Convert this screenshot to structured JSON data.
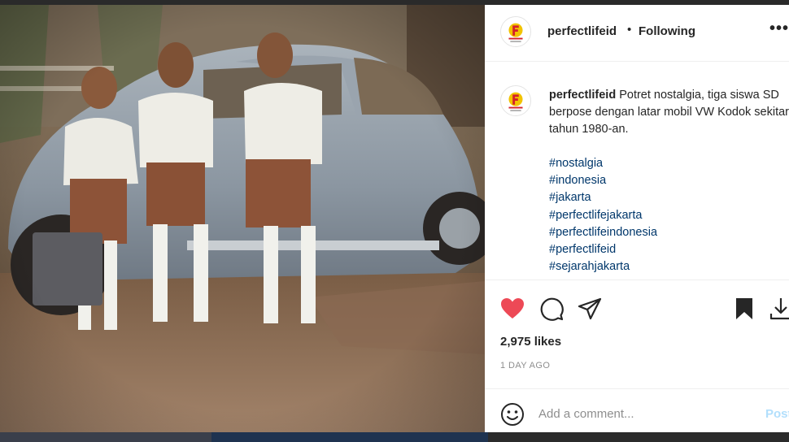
{
  "photo": {
    "description_icon": "vintage-photo"
  },
  "post": {
    "username": "perfectlifeid",
    "separator": "•",
    "follow_status": "Following",
    "more_icon": "ellipsis-icon",
    "more_label": "•••",
    "caption_user": "perfectlifeid",
    "caption_text": "Potret nostalgia, tiga siswa SD berpose dengan latar mobil VW Kodok sekitar tahun 1980-an.",
    "hashtags": [
      "#nostalgia",
      "#indonesia",
      "#jakarta",
      "#perfectlifejakarta",
      "#perfectlifeindonesia",
      "#perfectlifeid",
      "#sejarahjakarta"
    ],
    "likes": "2,975 likes",
    "time_ago": "1 DAY AGO",
    "liked": true
  },
  "actions": {
    "like_icon": "heart-icon",
    "comment_icon": "comment-icon",
    "share_icon": "share-icon",
    "save_icon": "bookmark-icon",
    "download_icon": "download-icon"
  },
  "comment": {
    "placeholder": "Add a comment...",
    "post_label": "Post",
    "emoji_icon": "smiley-icon"
  },
  "colors": {
    "like_red": "#ed4956",
    "hashtag_blue": "#00376b",
    "text": "#262626",
    "muted": "#8e8e8e",
    "post_disabled": "#b2dffc"
  }
}
